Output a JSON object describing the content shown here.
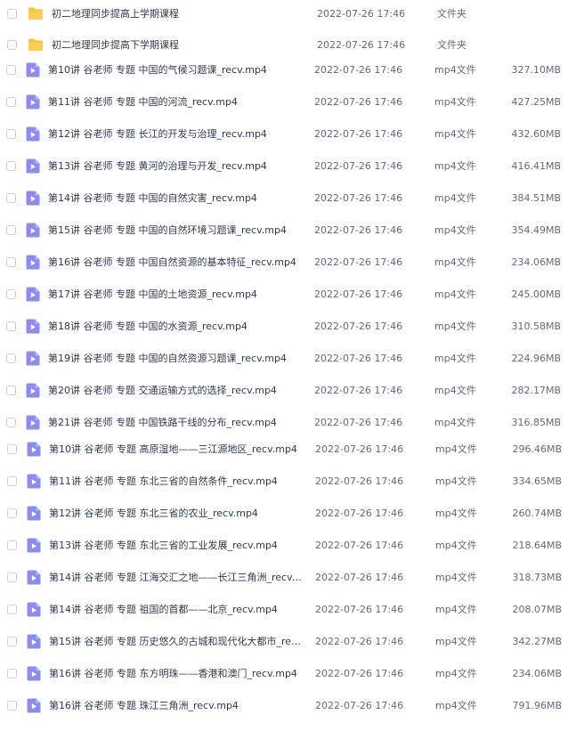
{
  "files": [
    {
      "name": "初二地理同步提高上学期课程",
      "date": "2022-07-26 17:46",
      "type": "文件夹",
      "size": "",
      "icon": "folder-icon"
    },
    {
      "name": "初二地理同步提高下学期课程",
      "date": "2022-07-26 17:46",
      "type": "文件夹",
      "size": "",
      "icon": "folder-icon"
    },
    {
      "name": "第10讲 谷老师 专题 中国的气候习题课_recv.mp4",
      "date": "2022-07-26 17:46",
      "type": "mp4文件",
      "size": "327.10MB",
      "icon": "video-icon"
    },
    {
      "name": "第11讲 谷老师 专题 中国的河流_recv.mp4",
      "date": "2022-07-26 17:46",
      "type": "mp4文件",
      "size": "427.25MB",
      "icon": "video-icon"
    },
    {
      "name": "第12讲 谷老师 专题 长江的开发与治理_recv.mp4",
      "date": "2022-07-26 17:46",
      "type": "mp4文件",
      "size": "432.60MB",
      "icon": "video-icon"
    },
    {
      "name": "第13讲 谷老师 专题 黄河的治理与开发_recv.mp4",
      "date": "2022-07-26 17:46",
      "type": "mp4文件",
      "size": "416.41MB",
      "icon": "video-icon"
    },
    {
      "name": "第14讲 谷老师 专题 中国的自然灾害_recv.mp4",
      "date": "2022-07-26 17:46",
      "type": "mp4文件",
      "size": "384.51MB",
      "icon": "video-icon"
    },
    {
      "name": "第15讲 谷老师 专题 中国的自然环境习题课_recv.mp4",
      "date": "2022-07-26 17:46",
      "type": "mp4文件",
      "size": "354.49MB",
      "icon": "video-icon"
    },
    {
      "name": "第16讲 谷老师 专题 中国自然资源的基本特征_recv.mp4",
      "date": "2022-07-26 17:46",
      "type": "mp4文件",
      "size": "234.06MB",
      "icon": "video-icon"
    },
    {
      "name": "第17讲 谷老师 专题 中国的土地资源_recv.mp4",
      "date": "2022-07-26 17:46",
      "type": "mp4文件",
      "size": "245.00MB",
      "icon": "video-icon"
    },
    {
      "name": "第18讲 谷老师 专题 中国的水资源_recv.mp4",
      "date": "2022-07-26 17:46",
      "type": "mp4文件",
      "size": "310.58MB",
      "icon": "video-icon"
    },
    {
      "name": "第19讲 谷老师 专题 中国的自然资源习题课_recv.mp4",
      "date": "2022-07-26 17:46",
      "type": "mp4文件",
      "size": "224.96MB",
      "icon": "video-icon"
    },
    {
      "name": "第20讲 谷老师 专题 交通运输方式的选择_recv.mp4",
      "date": "2022-07-26 17:46",
      "type": "mp4文件",
      "size": "282.17MB",
      "icon": "video-icon"
    },
    {
      "name": "第21讲 谷老师 专题 中国铁路干线的分布_recv.mp4",
      "date": "2022-07-26 17:46",
      "type": "mp4文件",
      "size": "316.85MB",
      "icon": "video-icon"
    },
    {
      "name": "第10讲 谷老师 专题 高原湿地——三江源地区_recv.mp4",
      "date": "2022-07-26 17:46",
      "type": "mp4文件",
      "size": "296.46MB",
      "icon": "video-icon"
    },
    {
      "name": "第11讲 谷老师 专题 东北三省的自然条件_recv.mp4",
      "date": "2022-07-26 17:46",
      "type": "mp4文件",
      "size": "334.65MB",
      "icon": "video-icon"
    },
    {
      "name": "第12讲 谷老师 专题 东北三省的农业_recv.mp4",
      "date": "2022-07-26 17:46",
      "type": "mp4文件",
      "size": "260.74MB",
      "icon": "video-icon"
    },
    {
      "name": "第13讲 谷老师 专题 东北三省的工业发展_recv.mp4",
      "date": "2022-07-26 17:46",
      "type": "mp4文件",
      "size": "218.64MB",
      "icon": "video-icon"
    },
    {
      "name": "第14讲 谷老师 专题 江海交汇之地——长江三角洲_recv....",
      "date": "2022-07-26 17:46",
      "type": "mp4文件",
      "size": "318.73MB",
      "icon": "video-icon"
    },
    {
      "name": "第14讲 谷老师 专题 祖国的首都——北京_recv.mp4",
      "date": "2022-07-26 17:46",
      "type": "mp4文件",
      "size": "208.07MB",
      "icon": "video-icon"
    },
    {
      "name": "第15讲 谷老师 专题 历史悠久的古城和现代化大都市_rec...",
      "date": "2022-07-26 17:46",
      "type": "mp4文件",
      "size": "342.27MB",
      "icon": "video-icon"
    },
    {
      "name": "第16讲 谷老师 专题 东方明珠——香港和澳门_recv.mp4",
      "date": "2022-07-26 17:46",
      "type": "mp4文件",
      "size": "234.06MB",
      "icon": "video-icon"
    },
    {
      "name": "第16讲 谷老师 专题 珠江三角洲_recv.mp4",
      "date": "2022-07-26 17:46",
      "type": "mp4文件",
      "size": "791.96MB",
      "icon": "video-icon"
    }
  ],
  "colors": {
    "folder": "#f7c244",
    "video": "#8c8cf0",
    "text": "#313a4c",
    "muted": "#636a7a",
    "checkbox_border": "#c9ced8"
  }
}
